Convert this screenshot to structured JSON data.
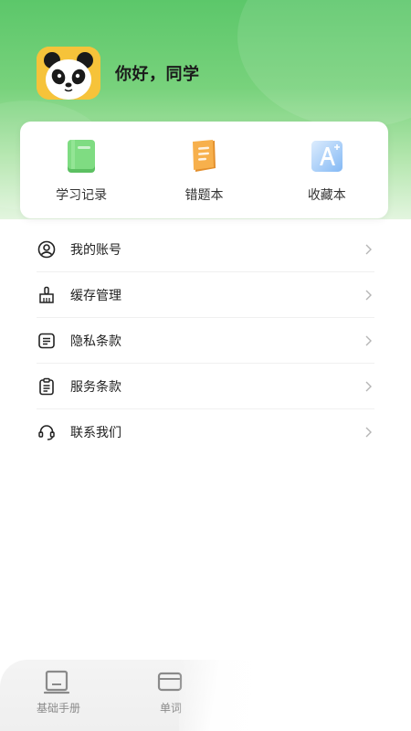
{
  "user": {
    "greeting": "你好，同学",
    "avatar_icon": "panda-avatar",
    "avatar_bg": "#f6c33a"
  },
  "theme": {
    "primary_green": "#5cc76a"
  },
  "shortcuts": [
    {
      "label": "学习记录",
      "icon": "green-book-icon",
      "color": "#6bd36f"
    },
    {
      "label": "错题本",
      "icon": "orange-notebook-icon",
      "color": "#f5a640"
    },
    {
      "label": "收藏本",
      "icon": "blue-letter-a-icon",
      "color": "#7fb7f5"
    }
  ],
  "menu": [
    {
      "label": "我的账号",
      "icon": "user-circle-icon"
    },
    {
      "label": "缓存管理",
      "icon": "broom-icon"
    },
    {
      "label": "隐私条款",
      "icon": "document-lines-icon"
    },
    {
      "label": "服务条款",
      "icon": "clipboard-icon"
    },
    {
      "label": "联系我们",
      "icon": "headset-icon"
    }
  ],
  "tabbar": [
    {
      "label": "基础手册",
      "icon": "book-tab-icon"
    },
    {
      "label": "单词",
      "icon": "card-tab-icon"
    }
  ]
}
